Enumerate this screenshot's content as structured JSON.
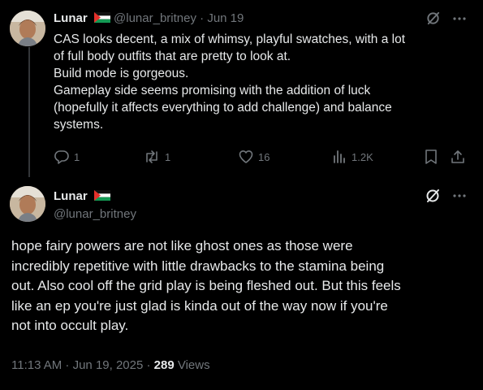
{
  "reply_tweet": {
    "display_name": "Lunar",
    "handle": "@lunar_britney",
    "separator": "·",
    "date": "Jun 19",
    "lines": [
      "CAS looks decent, a mix of whimsy, playful swatches, with a lot",
      "of full body outfits that are pretty to look at.",
      "Build mode is gorgeous.",
      "Gameplay side seems promising with the addition of luck",
      "(hopefully it affects everything to add challenge) and balance",
      "systems."
    ],
    "stats": {
      "replies": "1",
      "reposts": "1",
      "likes": "16",
      "views": "1.2K"
    }
  },
  "main_tweet": {
    "display_name": "Lunar",
    "handle": "@lunar_britney",
    "lines": [
      "hope fairy powers are not like ghost ones as those were",
      "incredibly repetitive with little drawbacks to the stamina being",
      "out. Also cool off the grid play is being fleshed out. But this feels",
      "like an ep you're just glad is kinda out of the way now if you're",
      "not into occult play."
    ],
    "timestamp": "11:13 AM · Jun 19, 2025 · ",
    "views_count": "289",
    "views_label": " Views"
  },
  "icons": {
    "flag": "palestine-flag",
    "grok": "grok-icon",
    "more": "more-icon",
    "reply": "reply-icon",
    "repost": "repost-icon",
    "like": "heart-icon",
    "views": "views-icon",
    "bookmark": "bookmark-icon",
    "share": "share-icon"
  },
  "colors": {
    "background": "#000000",
    "text": "#e7e9ea",
    "muted": "#71767b",
    "divider": "#2f3336"
  }
}
